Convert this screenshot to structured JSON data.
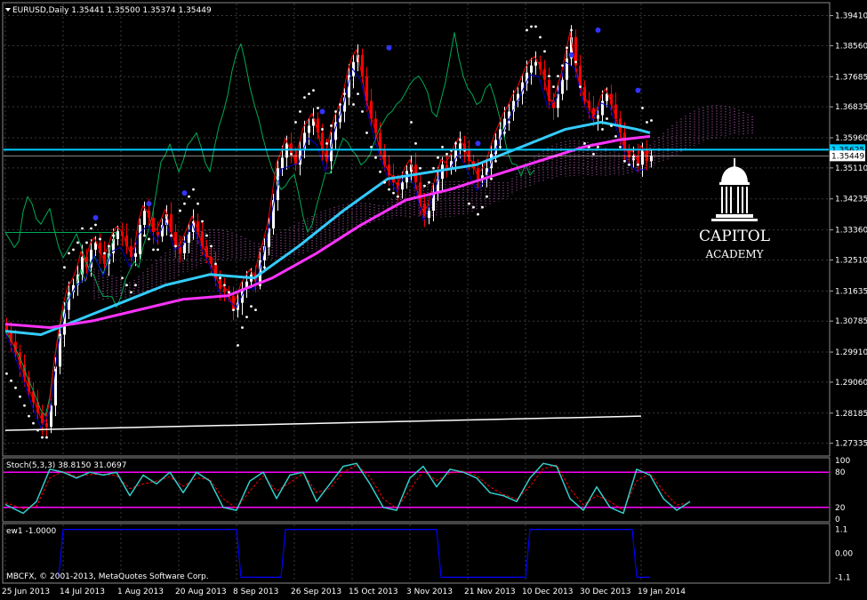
{
  "main_header": "EURUSD,Daily  1.35441 1.35500 1.35374 1.35449",
  "stoch_header": "Stoch(5,3,3) 38.8150 31.0697",
  "ew_header": "ew1 -1.0000",
  "copyright": "MBCFX, © 2001-2013, MetaQuotes Software Corp.",
  "logo": {
    "line1": "CAPITOL",
    "line2": "ACADEMY"
  },
  "colors": {
    "background": "#000000",
    "grid": "#3a3a3a",
    "bull": "#ffffff",
    "bear": "#ff0000",
    "sma_fast": "#33ccff",
    "sma_slow": "#ff33ff",
    "stoch_main": "#33cccc",
    "stoch_signal": "#ff0000",
    "stoch_levels": "#ff00ff",
    "ew": "#0000ff",
    "psar": "#ffffff",
    "tenkan": "#ff0000",
    "kijun": "#0000cc",
    "chikou": "#00aa55",
    "cloud": "#cc66cc",
    "hline": "#00ccff"
  },
  "chart_data": [
    {
      "type": "candlestick",
      "instrument": "EURUSD",
      "timeframe": "Daily",
      "ohlc_last": {
        "open": 1.35441,
        "high": 1.355,
        "low": 1.35374,
        "close": 1.35449
      },
      "y_ticks": [
        "1.39410",
        "1.38560",
        "1.37685",
        "1.36835",
        "1.35960",
        "1.35110",
        "1.34235",
        "1.33360",
        "1.32510",
        "1.31635",
        "1.30785",
        "1.29910",
        "1.29060",
        "1.28185",
        "1.27335"
      ],
      "y_tick_values": [
        1.3941,
        1.3856,
        1.37685,
        1.36835,
        1.3596,
        1.3511,
        1.34235,
        1.3336,
        1.3251,
        1.31635,
        1.30785,
        1.2991,
        1.2906,
        1.28185,
        1.27335
      ],
      "ylim": [
        1.2705,
        1.397
      ],
      "price_labels": [
        {
          "text": "1.35625",
          "value": 1.35625,
          "color": "#00ccff"
        },
        {
          "text": "1.35449",
          "value": 1.35449,
          "color": "#ffffff"
        }
      ],
      "x_ticks": [
        "25 Jun 2013",
        "14 Jul 2013",
        "1 Aug 2013",
        "20 Aug 2013",
        "8 Sep 2013",
        "26 Sep 2013",
        "15 Oct 2013",
        "3 Nov 2013",
        "21 Nov 2013",
        "10 Dec 2013",
        "30 Dec 2013",
        "19 Jan 2014"
      ],
      "x_tick_bars": [
        0,
        13,
        26,
        39,
        52,
        65,
        78,
        91,
        104,
        117,
        130,
        143
      ],
      "bar_count": 146,
      "closes": [
        1.305,
        1.302,
        1.299,
        1.2955,
        1.292,
        1.288,
        1.285,
        1.282,
        1.279,
        1.278,
        1.284,
        1.295,
        1.304,
        1.311,
        1.316,
        1.318,
        1.321,
        1.326,
        1.323,
        1.328,
        1.33,
        1.327,
        1.324,
        1.327,
        1.331,
        1.333,
        1.332,
        1.329,
        1.326,
        1.327,
        1.335,
        1.339,
        1.337,
        1.333,
        1.332,
        1.335,
        1.338,
        1.333,
        1.329,
        1.327,
        1.33,
        1.333,
        1.336,
        1.333,
        1.329,
        1.326,
        1.324,
        1.32,
        1.317,
        1.316,
        1.315,
        1.311,
        1.313,
        1.317,
        1.319,
        1.321,
        1.319,
        1.325,
        1.329,
        1.334,
        1.342,
        1.351,
        1.354,
        1.358,
        1.355,
        1.352,
        1.356,
        1.361,
        1.363,
        1.365,
        1.361,
        1.356,
        1.353,
        1.359,
        1.364,
        1.367,
        1.371,
        1.377,
        1.381,
        1.383,
        1.377,
        1.37,
        1.365,
        1.361,
        1.356,
        1.352,
        1.349,
        1.347,
        1.345,
        1.347,
        1.35,
        1.352,
        1.347,
        1.341,
        1.337,
        1.339,
        1.344,
        1.348,
        1.352,
        1.351,
        1.353,
        1.356,
        1.358,
        1.356,
        1.353,
        1.351,
        1.348,
        1.349,
        1.351,
        1.355,
        1.359,
        1.362,
        1.365,
        1.367,
        1.37,
        1.372,
        1.375,
        1.378,
        1.38,
        1.381,
        1.379,
        1.376,
        1.37,
        1.368,
        1.372,
        1.376,
        1.382,
        1.388,
        1.38,
        1.374,
        1.37,
        1.368,
        1.365,
        1.366,
        1.37,
        1.372,
        1.369,
        1.365,
        1.361,
        1.356,
        1.354,
        1.3545,
        1.352,
        1.356,
        1.353,
        1.3545
      ],
      "sma_fast": [
        [
          0,
          1.305
        ],
        [
          8,
          1.304
        ],
        [
          16,
          1.308
        ],
        [
          26,
          1.313
        ],
        [
          36,
          1.318
        ],
        [
          46,
          1.321
        ],
        [
          56,
          1.32
        ],
        [
          66,
          1.329
        ],
        [
          76,
          1.339
        ],
        [
          86,
          1.348
        ],
        [
          96,
          1.35
        ],
        [
          106,
          1.352
        ],
        [
          116,
          1.357
        ],
        [
          126,
          1.362
        ],
        [
          134,
          1.364
        ],
        [
          142,
          1.362
        ],
        [
          145,
          1.361
        ]
      ],
      "sma_slow": [
        [
          0,
          1.307
        ],
        [
          10,
          1.306
        ],
        [
          20,
          1.308
        ],
        [
          30,
          1.311
        ],
        [
          40,
          1.314
        ],
        [
          50,
          1.315
        ],
        [
          60,
          1.32
        ],
        [
          70,
          1.327
        ],
        [
          80,
          1.335
        ],
        [
          90,
          1.342
        ],
        [
          100,
          1.345
        ],
        [
          110,
          1.349
        ],
        [
          120,
          1.353
        ],
        [
          130,
          1.357
        ],
        [
          138,
          1.359
        ],
        [
          145,
          1.36
        ]
      ],
      "support_line": [
        [
          0,
          1.277
        ],
        [
          143,
          1.281
        ]
      ],
      "markers": [
        [
          20,
          1.337
        ],
        [
          32,
          1.341
        ],
        [
          40,
          1.344
        ],
        [
          71,
          1.367
        ],
        [
          86,
          1.385
        ],
        [
          106,
          1.358
        ],
        [
          127,
          1.383
        ],
        [
          133,
          1.39
        ],
        [
          142,
          1.373
        ]
      ]
    },
    {
      "type": "line",
      "name": "Stoch(5,3,3)",
      "main_value": 38.815,
      "signal_value": 31.0697,
      "ylim": [
        0,
        100
      ],
      "levels": [
        20,
        80
      ],
      "y_ticks": [
        "100",
        "80",
        "20",
        "0"
      ],
      "main": [
        [
          0,
          25
        ],
        [
          4,
          10
        ],
        [
          7,
          30
        ],
        [
          10,
          85
        ],
        [
          13,
          80
        ],
        [
          16,
          70
        ],
        [
          19,
          80
        ],
        [
          22,
          75
        ],
        [
          25,
          80
        ],
        [
          28,
          40
        ],
        [
          31,
          75
        ],
        [
          34,
          60
        ],
        [
          37,
          80
        ],
        [
          40,
          45
        ],
        [
          43,
          80
        ],
        [
          46,
          65
        ],
        [
          49,
          20
        ],
        [
          52,
          15
        ],
        [
          55,
          65
        ],
        [
          58,
          80
        ],
        [
          61,
          35
        ],
        [
          64,
          75
        ],
        [
          67,
          80
        ],
        [
          70,
          30
        ],
        [
          73,
          60
        ],
        [
          76,
          90
        ],
        [
          79,
          95
        ],
        [
          82,
          60
        ],
        [
          85,
          20
        ],
        [
          88,
          15
        ],
        [
          91,
          70
        ],
        [
          94,
          90
        ],
        [
          97,
          55
        ],
        [
          100,
          85
        ],
        [
          103,
          80
        ],
        [
          106,
          70
        ],
        [
          109,
          45
        ],
        [
          112,
          40
        ],
        [
          115,
          30
        ],
        [
          118,
          70
        ],
        [
          121,
          95
        ],
        [
          124,
          90
        ],
        [
          127,
          35
        ],
        [
          130,
          15
        ],
        [
          133,
          55
        ],
        [
          136,
          20
        ],
        [
          139,
          10
        ],
        [
          142,
          85
        ],
        [
          145,
          75
        ],
        [
          148,
          35
        ],
        [
          151,
          15
        ],
        [
          154,
          30
        ]
      ],
      "signal": [
        [
          0,
          28
        ],
        [
          4,
          18
        ],
        [
          7,
          22
        ],
        [
          10,
          70
        ],
        [
          13,
          82
        ],
        [
          16,
          72
        ],
        [
          19,
          76
        ],
        [
          22,
          77
        ],
        [
          25,
          74
        ],
        [
          28,
          52
        ],
        [
          31,
          60
        ],
        [
          34,
          65
        ],
        [
          37,
          72
        ],
        [
          40,
          56
        ],
        [
          43,
          70
        ],
        [
          46,
          68
        ],
        [
          49,
          35
        ],
        [
          52,
          18
        ],
        [
          55,
          48
        ],
        [
          58,
          74
        ],
        [
          61,
          48
        ],
        [
          64,
          62
        ],
        [
          67,
          78
        ],
        [
          70,
          45
        ],
        [
          73,
          52
        ],
        [
          76,
          80
        ],
        [
          79,
          92
        ],
        [
          82,
          72
        ],
        [
          85,
          35
        ],
        [
          88,
          18
        ],
        [
          91,
          50
        ],
        [
          94,
          82
        ],
        [
          97,
          66
        ],
        [
          100,
          78
        ],
        [
          103,
          82
        ],
        [
          106,
          74
        ],
        [
          109,
          55
        ],
        [
          112,
          42
        ],
        [
          115,
          34
        ],
        [
          118,
          56
        ],
        [
          121,
          86
        ],
        [
          124,
          92
        ],
        [
          127,
          52
        ],
        [
          130,
          24
        ],
        [
          133,
          40
        ],
        [
          136,
          30
        ],
        [
          139,
          15
        ],
        [
          142,
          65
        ],
        [
          145,
          78
        ],
        [
          148,
          48
        ],
        [
          151,
          24
        ],
        [
          154,
          28
        ]
      ]
    },
    {
      "type": "line",
      "name": "ew1",
      "value": -1.0,
      "ylim": [
        -1.25,
        1.25
      ],
      "y_ticks": [
        "1.1",
        "0.00",
        "-1.1"
      ],
      "y_tick_values": [
        1.1,
        0,
        -1.1
      ],
      "step": [
        [
          12,
          -1.1
        ],
        [
          13,
          1.1
        ],
        [
          52,
          1.1
        ],
        [
          53,
          -1.1
        ],
        [
          62,
          -1.1
        ],
        [
          63,
          1.1
        ],
        [
          97,
          1.1
        ],
        [
          98,
          -1.1
        ],
        [
          117,
          -1.1
        ],
        [
          118,
          1.1
        ],
        [
          141,
          1.1
        ],
        [
          142,
          -1.1
        ],
        [
          145,
          -1.1
        ]
      ]
    }
  ]
}
